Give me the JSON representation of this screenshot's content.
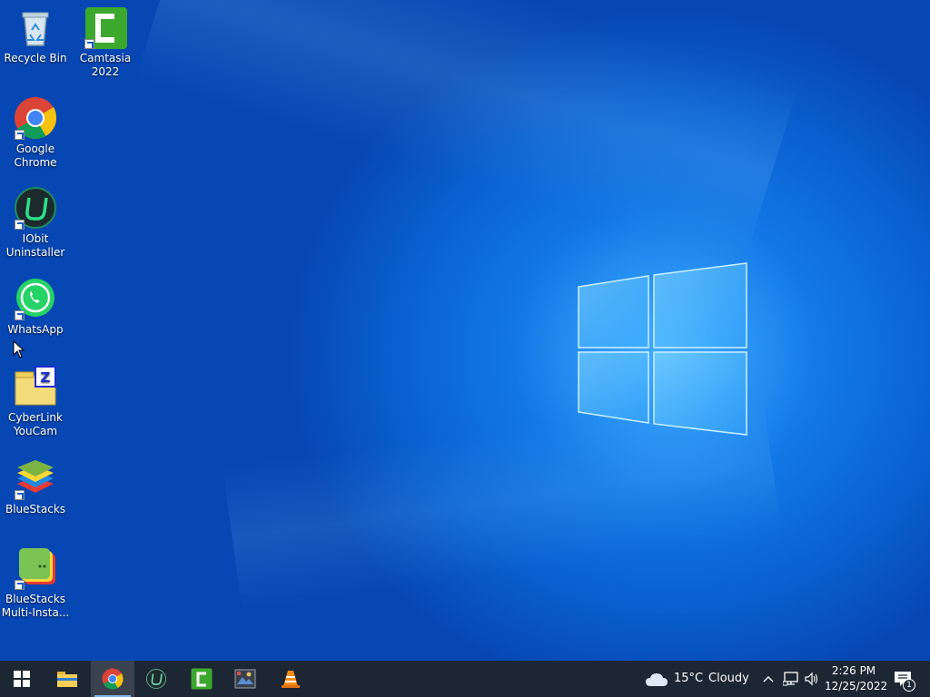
{
  "desktop_icons": [
    {
      "label": "Recycle Bin",
      "icon": "recycle-bin-icon"
    },
    {
      "label": "Camtasia 2022",
      "icon": "camtasia-icon"
    },
    {
      "label": "Google Chrome",
      "icon": "chrome-icon"
    },
    {
      "label": "IObit Uninstaller",
      "icon": "iobit-uninstaller-icon"
    },
    {
      "label": "WhatsApp",
      "icon": "whatsapp-icon"
    },
    {
      "label": "CyberLink YouCam",
      "icon": "youcam-icon"
    },
    {
      "label": "BlueStacks",
      "icon": "bluestacks-icon"
    },
    {
      "label": "BlueStacks Multi-Insta...",
      "icon": "bluestacks-multi-instance-icon"
    }
  ],
  "taskbar": {
    "pinned": [
      "start-icon",
      "file-explorer-icon",
      "chrome-icon",
      "iobit-uninstaller-icon",
      "camtasia-icon",
      "photo-app-icon",
      "vlc-icon"
    ],
    "active_app": "chrome-icon",
    "weather": {
      "temperature": "15°C",
      "condition": "Cloudy",
      "icon": "cloud-icon"
    },
    "tray_icons": [
      "chevron-up-icon",
      "network-icon",
      "volume-icon"
    ],
    "time": "2:26 PM",
    "date": "12/25/2022",
    "notification_count": "1"
  },
  "colors": {
    "taskbar_bg": "#1d2733",
    "desktop_blue": "#0a62d2",
    "active_indicator": "#7cb7f0"
  }
}
